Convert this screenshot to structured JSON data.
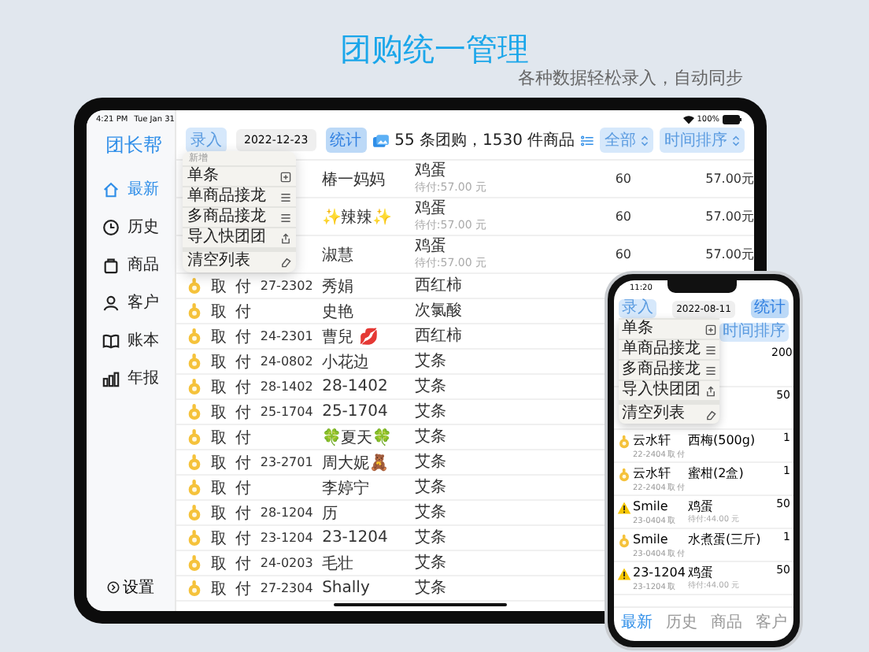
{
  "headline": {
    "title": "团购统一管理",
    "subtitle": "各种数据轻松录入，自动同步"
  },
  "tablet": {
    "status_bar": {
      "time": "4:21 PM",
      "date": "Tue Jan 31",
      "battery": "100%"
    },
    "sidebar": {
      "logo": "团长帮",
      "items": [
        {
          "label": "最新",
          "selected": true
        },
        {
          "label": "历史",
          "selected": false
        },
        {
          "label": "商品",
          "selected": false
        },
        {
          "label": "客户",
          "selected": false
        },
        {
          "label": "账本",
          "selected": false
        },
        {
          "label": "年报",
          "selected": false
        }
      ],
      "settings": "设置"
    },
    "toolbar": {
      "entry_button": "录入",
      "date": "2022-12-23",
      "stats_button": "统计",
      "summary": "55 条团购，1530 件商品",
      "filter_button": "全部",
      "sort_button": "时间排序"
    },
    "menu": {
      "header": "新增",
      "items": [
        {
          "label": "单条",
          "separated": false
        },
        {
          "label": "单商品接龙",
          "separated": false
        },
        {
          "label": "多商品接龙",
          "separated": false
        },
        {
          "label": "导入快团团",
          "separated": false
        },
        {
          "label": "清空列表",
          "separated": true
        }
      ]
    },
    "rows": [
      {
        "name": "椿一妈妈",
        "product": "鸡蛋",
        "due": "待付:57.00 元",
        "qty": "60",
        "price": "57.00元"
      },
      {
        "name": "✨辣辣✨",
        "product": "鸡蛋",
        "due": "待付:57.00 元",
        "qty": "60",
        "price": "57.00元"
      },
      {
        "name": "淑慧",
        "product": "鸡蛋",
        "due": "待付:57.00 元",
        "qty": "60",
        "price": "57.00元"
      },
      {
        "kind": "ok",
        "pickup": "取",
        "pay": "付",
        "room": "27-2302",
        "name": "秀娟",
        "product": "西红柿"
      },
      {
        "kind": "ok",
        "pickup": "取",
        "pay": "付",
        "name": "史艳",
        "product": "次氯酸"
      },
      {
        "kind": "ok",
        "pickup": "取",
        "pay": "付",
        "room": "24-2301",
        "name": "曹兒 💋",
        "product": "西红柿"
      },
      {
        "kind": "ok",
        "pickup": "取",
        "pay": "付",
        "room": "24-0802",
        "name": "小花边",
        "product": "艾条"
      },
      {
        "kind": "ok",
        "pickup": "取",
        "pay": "付",
        "room": "28-1402",
        "name": "28-1402",
        "product": "艾条"
      },
      {
        "kind": "ok",
        "pickup": "取",
        "pay": "付",
        "room": "25-1704",
        "name": "25-1704",
        "product": "艾条"
      },
      {
        "kind": "ok",
        "pickup": "取",
        "pay": "付",
        "name": "🍀夏天🍀",
        "product": "艾条"
      },
      {
        "kind": "ok",
        "pickup": "取",
        "pay": "付",
        "room": "23-2701",
        "name": "周大妮🧸",
        "product": "艾条"
      },
      {
        "kind": "ok",
        "pickup": "取",
        "pay": "付",
        "name": "李婷宁",
        "product": "艾条"
      },
      {
        "kind": "ok",
        "pickup": "取",
        "pay": "付",
        "room": "28-1204",
        "name": "历",
        "product": "艾条"
      },
      {
        "kind": "ok",
        "pickup": "取",
        "pay": "付",
        "room": "23-1204",
        "name": "23-1204",
        "product": "艾条"
      },
      {
        "kind": "ok",
        "pickup": "取",
        "pay": "付",
        "room": "24-0203",
        "name": "毛壮",
        "product": "艾条"
      },
      {
        "kind": "ok",
        "pickup": "取",
        "pay": "付",
        "room": "27-2304",
        "name": "Shally",
        "product": "艾条"
      }
    ]
  },
  "phone": {
    "time": "11:20",
    "entry_button": "录入",
    "date": "2022-08-11",
    "stats_button": "统计",
    "sort_button": "时间排序",
    "menu": [
      {
        "label": "单条",
        "separated": false
      },
      {
        "label": "单商品接龙",
        "separated": false
      },
      {
        "label": "多商品接龙",
        "separated": false
      },
      {
        "label": "导入快团团",
        "separated": false
      },
      {
        "label": "清空列表",
        "separated": true
      }
    ],
    "rows": [
      {
        "qty": "200"
      },
      {
        "qty": "50"
      },
      {
        "kind": "ok",
        "name": "云水轩",
        "room": "22-2404",
        "pickup": "取",
        "pay": "付",
        "product": "西梅(500g)",
        "qty": "1"
      },
      {
        "kind": "ok",
        "name": "云水轩",
        "room": "22-2404",
        "pickup": "取",
        "pay": "付",
        "product": "蜜柑(2盒)",
        "qty": "1"
      },
      {
        "kind": "warning",
        "name": "Smile",
        "room": "23-0404",
        "pickup": "取",
        "product": "鸡蛋",
        "due": "待付:44.00 元",
        "qty": "50"
      },
      {
        "kind": "ok",
        "name": "Smile",
        "room": "23-0404",
        "pickup": "取",
        "pay": "付",
        "product": "水煮蛋(三斤)",
        "qty": "1"
      },
      {
        "kind": "warning",
        "name": "23-1204",
        "room": "23-1204",
        "pickup": "取",
        "product": "鸡蛋",
        "due": "待付:44.00 元",
        "qty": "50"
      }
    ],
    "tabs": [
      {
        "label": "最新",
        "selected": true
      },
      {
        "label": "历史",
        "selected": false
      },
      {
        "label": "商品",
        "selected": false
      },
      {
        "label": "客户",
        "selected": false
      }
    ]
  }
}
